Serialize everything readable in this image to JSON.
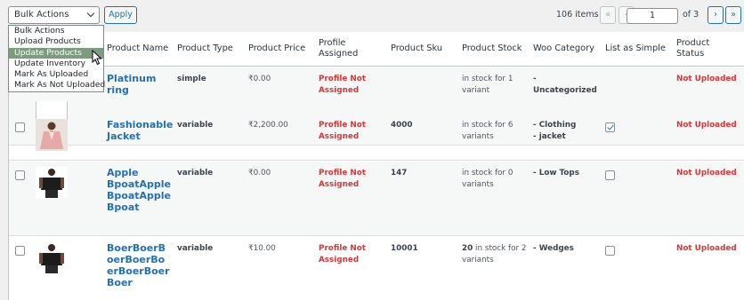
{
  "toolbar": {
    "bulk_actions_value": "Bulk Actions",
    "apply_label": "Apply",
    "items_count": "106 items",
    "first_page": "«",
    "prev_page": "‹",
    "current_page": "1",
    "of_pages": "of 3",
    "next_page": "›",
    "last_page": "»"
  },
  "dropdown": {
    "options": [
      "Bulk Actions",
      "Upload Products",
      "Update Products",
      "Update Inventory",
      "Mark As Uploaded",
      "Mark As Not Uploaded"
    ],
    "selected_index": 2
  },
  "table": {
    "headers": {
      "name": "Product Name",
      "type": "Product Type",
      "price": "Product Price",
      "profile_l1": "Profile",
      "profile_l2": "Assigned",
      "sku": "Product Sku",
      "stock": "Product Stock",
      "category": "Woo Category",
      "simple": "List as Simple",
      "status_l1": "Product",
      "status_l2": "Status"
    },
    "rows": [
      {
        "name": "Platinum ring",
        "type": "simple",
        "price": "₹0.00",
        "profile_l1": "Profile Not",
        "profile_l2": "Assigned",
        "sku": "",
        "stock_prefix": "",
        "stock_l1": "in stock for 1",
        "stock_l2": "variant",
        "category_l1": "-",
        "category_l2": "Uncategorized",
        "list_as_simple": false,
        "status": "Not Uploaded"
      },
      {
        "name": "Fashionable Jacket",
        "type": "variable",
        "price": "₹2,200.00",
        "profile_l1": "Profile Not",
        "profile_l2": "Assigned",
        "sku": "4000",
        "stock_prefix": "",
        "stock_l1": "in stock for 6",
        "stock_l2": "variants",
        "category_l1": "- Clothing",
        "category_l2": "- jacket",
        "list_as_simple": true,
        "status": "Not Uploaded"
      },
      {
        "name": "Apple BpoatApple BpoatApple Bpoat",
        "type": "variable",
        "price": "₹0.00",
        "profile_l1": "Profile Not",
        "profile_l2": "Assigned",
        "sku": "147",
        "stock_prefix": "",
        "stock_l1": "in stock for 0",
        "stock_l2": "variants",
        "category_l1": "- Low Tops",
        "category_l2": "",
        "list_as_simple": false,
        "status": "Not Uploaded"
      },
      {
        "name": "BoerBoerBoerBoerBoerBoerBoerBoer",
        "type": "variable",
        "price": "₹10.00",
        "profile_l1": "Profile Not",
        "profile_l2": "Assigned",
        "sku": "10001",
        "stock_prefix": "20",
        "stock_l1": " in stock for 2",
        "stock_l2": "variants",
        "category_l1": "- Wedges",
        "category_l2": "",
        "list_as_simple": false,
        "status": "Not Uploaded"
      }
    ]
  },
  "colors": {
    "link": "#2271b1",
    "danger": "#d63638",
    "dropdown_selected": "#7d9c7d"
  }
}
